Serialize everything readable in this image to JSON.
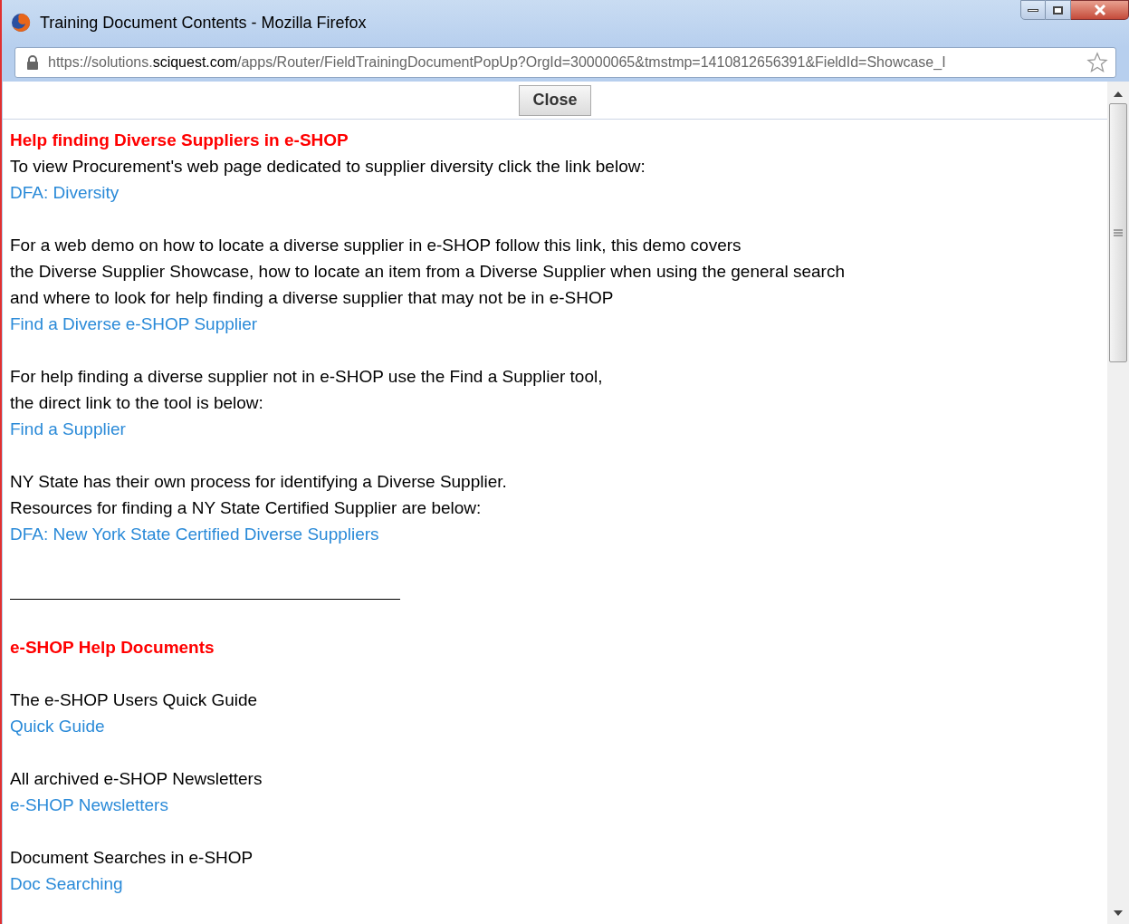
{
  "window": {
    "title": "Training Document Contents - Mozilla Firefox"
  },
  "address_bar": {
    "url": "https://solutions.**sciquest.com**/apps/Router/FieldTrainingDocumentPopUp?OrgId=30000065&tmstmp=1410812656391&FieldId=Showcase_I"
  },
  "close_button": "Close",
  "sections": [
    {
      "kind": "block",
      "lines": [
        {
          "kind": "heading",
          "text": "Help finding Diverse Suppliers in e-SHOP"
        },
        {
          "kind": "text",
          "text": "To view Procurement's web page dedicated to supplier diversity click the link below:"
        },
        {
          "kind": "link",
          "text": "DFA: Diversity"
        }
      ]
    },
    {
      "kind": "block",
      "lines": [
        {
          "kind": "text",
          "text": "For a web demo on how to locate a diverse supplier in e-SHOP follow this link, this demo covers"
        },
        {
          "kind": "text",
          "text": "the Diverse Supplier Showcase, how to locate an item from a Diverse Supplier when using the general search"
        },
        {
          "kind": "text",
          "text": "and where to look for help finding a diverse supplier that may not be in e-SHOP"
        },
        {
          "kind": "link",
          "text": "Find a Diverse e-SHOP Supplier"
        }
      ]
    },
    {
      "kind": "block",
      "lines": [
        {
          "kind": "text",
          "text": "For help finding a diverse supplier not in e-SHOP use the Find a Supplier tool,"
        },
        {
          "kind": "text",
          "text": "the direct link to the tool is below:"
        },
        {
          "kind": "link",
          "text": "Find a Supplier"
        }
      ]
    },
    {
      "kind": "block",
      "lines": [
        {
          "kind": "text",
          "text": "NY State has their own process for identifying a Diverse Supplier."
        },
        {
          "kind": "text",
          "text": "Resources for finding a NY State Certified Supplier are below:"
        },
        {
          "kind": "link",
          "text": "DFA: New York State Certified Diverse Suppliers"
        }
      ]
    },
    {
      "kind": "rule"
    },
    {
      "kind": "block",
      "lines": [
        {
          "kind": "heading",
          "text": "e-SHOP Help Documents"
        }
      ]
    },
    {
      "kind": "block",
      "lines": [
        {
          "kind": "text",
          "text": "The e-SHOP Users Quick Guide"
        },
        {
          "kind": "link",
          "text": "Quick Guide"
        }
      ]
    },
    {
      "kind": "block",
      "lines": [
        {
          "kind": "text",
          "text": "All archived e-SHOP Newsletters"
        },
        {
          "kind": "link",
          "text": "e-SHOP Newsletters"
        }
      ]
    },
    {
      "kind": "block",
      "lines": [
        {
          "kind": "text",
          "text": "Document Searches in e-SHOP"
        },
        {
          "kind": "link",
          "text": "Doc Searching"
        }
      ]
    }
  ]
}
